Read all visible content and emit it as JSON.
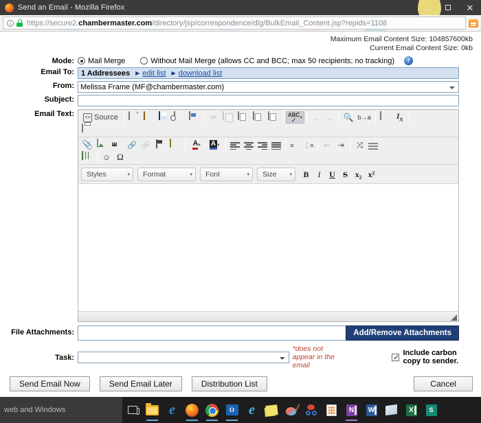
{
  "browser": {
    "window_title": "Send an Email - Mozilla Firefox",
    "url_scheme": "https://secure2.",
    "url_host": "chambermaster.com",
    "url_path": "/directory/jsp/correspondence/dlg/BulkEmail_Content.jsp?repids=1108",
    "minimize_label": "–",
    "maximize_label": "□",
    "close_label": "✕",
    "info_glyph": "i",
    "reader_btn_label": ""
  },
  "page": {
    "max_size_text": "Maximum Email Content Size: 104857600kb",
    "current_size_text": "Current Email Content Size: 0kb",
    "labels": {
      "mode": "Mode:",
      "email_to": "Email To:",
      "from": "From:",
      "subject": "Subject:",
      "email_text": "Email Text:",
      "file_attachments": "File Attachments:",
      "task": "Task:"
    },
    "mode": {
      "option1": "Mail Merge",
      "option2": "Without Mail Merge (allows CC and BCC; max 50 recipients; no tracking)",
      "selected": "Mail Merge",
      "help_glyph": "?"
    },
    "email_to": {
      "count_text": "1 Addressees",
      "edit_link": "edit list",
      "download_link": "download list",
      "arrow": "▶"
    },
    "from": {
      "value": "Melissa Frame (MF@chambermaster.com)",
      "options": [
        "Melissa Frame (MF@chambermaster.com)"
      ]
    },
    "subject": {
      "value": "",
      "placeholder": ""
    },
    "attachments": {
      "value": "",
      "button_label": "Add/Remove Attachments"
    },
    "task": {
      "value": "",
      "options": [
        ""
      ],
      "note": "*does not appear in the email"
    },
    "carbon_copy": {
      "label": "Include carbon copy to sender.",
      "checked": true,
      "check_glyph": "✓"
    },
    "buttons": {
      "send_now": "Send Email Now",
      "send_later": "Send Email Later",
      "distribution_list": "Distribution List",
      "cancel": "Cancel"
    }
  },
  "editor": {
    "body_content": "",
    "toolbar_row1": [
      {
        "name": "source-button",
        "label": "Source",
        "icon": "source-icon"
      },
      {
        "name": "new-page-button",
        "label": "",
        "icon": "new-page-icon"
      },
      {
        "name": "open-file-button",
        "label": "",
        "icon": "open-folder-icon"
      },
      {
        "name": "save-button",
        "label": "",
        "icon": "save-icon"
      },
      {
        "name": "preview-button",
        "label": "",
        "icon": "preview-icon"
      },
      {
        "name": "templates-button",
        "label": "",
        "icon": "templates-icon"
      },
      {
        "name": "cut-button",
        "label": "",
        "icon": "scissors-icon"
      },
      {
        "name": "copy-button",
        "label": "",
        "icon": "copy-icon"
      },
      {
        "name": "paste-button",
        "label": "",
        "icon": "paste-icon"
      },
      {
        "name": "paste-text-button",
        "label": "",
        "icon": "paste-text-icon"
      },
      {
        "name": "paste-word-button",
        "label": "",
        "icon": "paste-word-icon"
      },
      {
        "name": "spellcheck-button",
        "label": "",
        "icon": "spellcheck-icon"
      },
      {
        "name": "undo-button",
        "label": "",
        "icon": "undo-arrow-icon"
      },
      {
        "name": "redo-button",
        "label": "",
        "icon": "redo-arrow-icon"
      },
      {
        "name": "find-button",
        "label": "",
        "icon": "magnifier-icon"
      },
      {
        "name": "replace-button",
        "label": "",
        "icon": "replace-icon"
      },
      {
        "name": "select-all-button",
        "label": "",
        "icon": "select-all-icon"
      },
      {
        "name": "remove-format-button",
        "label": "",
        "icon": "remove-format-icon"
      },
      {
        "name": "print-button",
        "label": "",
        "icon": "printer-icon"
      }
    ],
    "toolbar_row2": [
      {
        "name": "attach-file-button",
        "icon": "paperclip-icon"
      },
      {
        "name": "insert-image-button",
        "icon": "image-icon"
      },
      {
        "name": "insert-flash-button",
        "icon": "flash-video-icon"
      },
      {
        "name": "insert-link-button",
        "icon": "link-icon"
      },
      {
        "name": "unlink-button",
        "icon": "unlink-icon"
      },
      {
        "name": "anchor-button",
        "icon": "flag-anchor-icon"
      },
      {
        "name": "insert-field-button",
        "icon": "yellow-box-icon"
      },
      {
        "name": "text-color-button",
        "icon": "text-color-icon"
      },
      {
        "name": "background-color-button",
        "icon": "background-color-icon"
      },
      {
        "name": "align-left-button",
        "icon": "align-left-icon"
      },
      {
        "name": "align-center-button",
        "icon": "align-center-icon"
      },
      {
        "name": "align-right-button",
        "icon": "align-right-icon"
      },
      {
        "name": "align-justify-button",
        "icon": "align-justify-icon"
      },
      {
        "name": "numbered-list-button",
        "icon": "numbered-list-icon"
      },
      {
        "name": "bulleted-list-button",
        "icon": "bulleted-list-icon"
      },
      {
        "name": "outdent-button",
        "icon": "outdent-icon"
      },
      {
        "name": "indent-button",
        "icon": "indent-icon"
      },
      {
        "name": "maximize-button",
        "icon": "maximize-icon"
      },
      {
        "name": "horizontal-rule-button",
        "icon": "horizontal-rule-icon"
      },
      {
        "name": "insert-table-button",
        "icon": "table-icon"
      },
      {
        "name": "smiley-button",
        "icon": "smiley-icon"
      },
      {
        "name": "special-char-button",
        "icon": "omega-icon"
      }
    ],
    "combos": [
      {
        "name": "styles-combo",
        "label": "Styles"
      },
      {
        "name": "format-combo",
        "label": "Format"
      },
      {
        "name": "font-combo",
        "label": "Font"
      },
      {
        "name": "size-combo",
        "label": "Size"
      }
    ],
    "format_buttons": [
      {
        "name": "bold-button",
        "label": "B"
      },
      {
        "name": "italic-button",
        "label": "I"
      },
      {
        "name": "underline-button",
        "label": "U"
      },
      {
        "name": "strikethrough-button",
        "label": "S"
      },
      {
        "name": "subscript-button",
        "label": "x₂"
      },
      {
        "name": "superscript-button",
        "label": "x²"
      }
    ],
    "source_label": "Source",
    "caret": "▾"
  },
  "taskbar": {
    "search_text": "web and Windows",
    "items": [
      {
        "name": "task-view-icon",
        "glyph": "task-view"
      },
      {
        "name": "file-explorer-icon",
        "glyph": "explorer",
        "open": true
      },
      {
        "name": "microsoft-edge-icon",
        "glyph": "edge"
      },
      {
        "name": "firefox-icon",
        "glyph": "firefox",
        "open": true
      },
      {
        "name": "google-chrome-icon",
        "glyph": "chrome",
        "open": true
      },
      {
        "name": "outlook-icon",
        "glyph": "outlook",
        "open": true
      },
      {
        "name": "internet-explorer-icon",
        "glyph": "ie"
      },
      {
        "name": "sticky-notes-icon",
        "glyph": "sticky"
      },
      {
        "name": "paint-icon",
        "glyph": "paint"
      },
      {
        "name": "snipping-tool-icon",
        "glyph": "snip"
      },
      {
        "name": "calculator-icon",
        "glyph": "calc"
      },
      {
        "name": "onenote-icon",
        "glyph": "onenote",
        "open": true
      },
      {
        "name": "word-icon",
        "glyph": "word"
      },
      {
        "name": "reader-icon",
        "glyph": "reader"
      },
      {
        "name": "excel-icon",
        "glyph": "excel"
      },
      {
        "name": "sharepoint-icon",
        "glyph": "sharepoint"
      }
    ],
    "glyph_labels": {
      "outlook": "O",
      "edge": "e",
      "ie": "e",
      "onenote": "N",
      "word": "W",
      "excel": "X",
      "sharepoint": "S"
    }
  },
  "colors": {
    "accent_blue": "#1f3f76",
    "link_blue": "#1f4fa8",
    "email_to_bg": "#d3e0f0",
    "note_red": "#c0392b",
    "titlebar": "#3b3b3b",
    "taskbar": "#1d1d1d"
  }
}
